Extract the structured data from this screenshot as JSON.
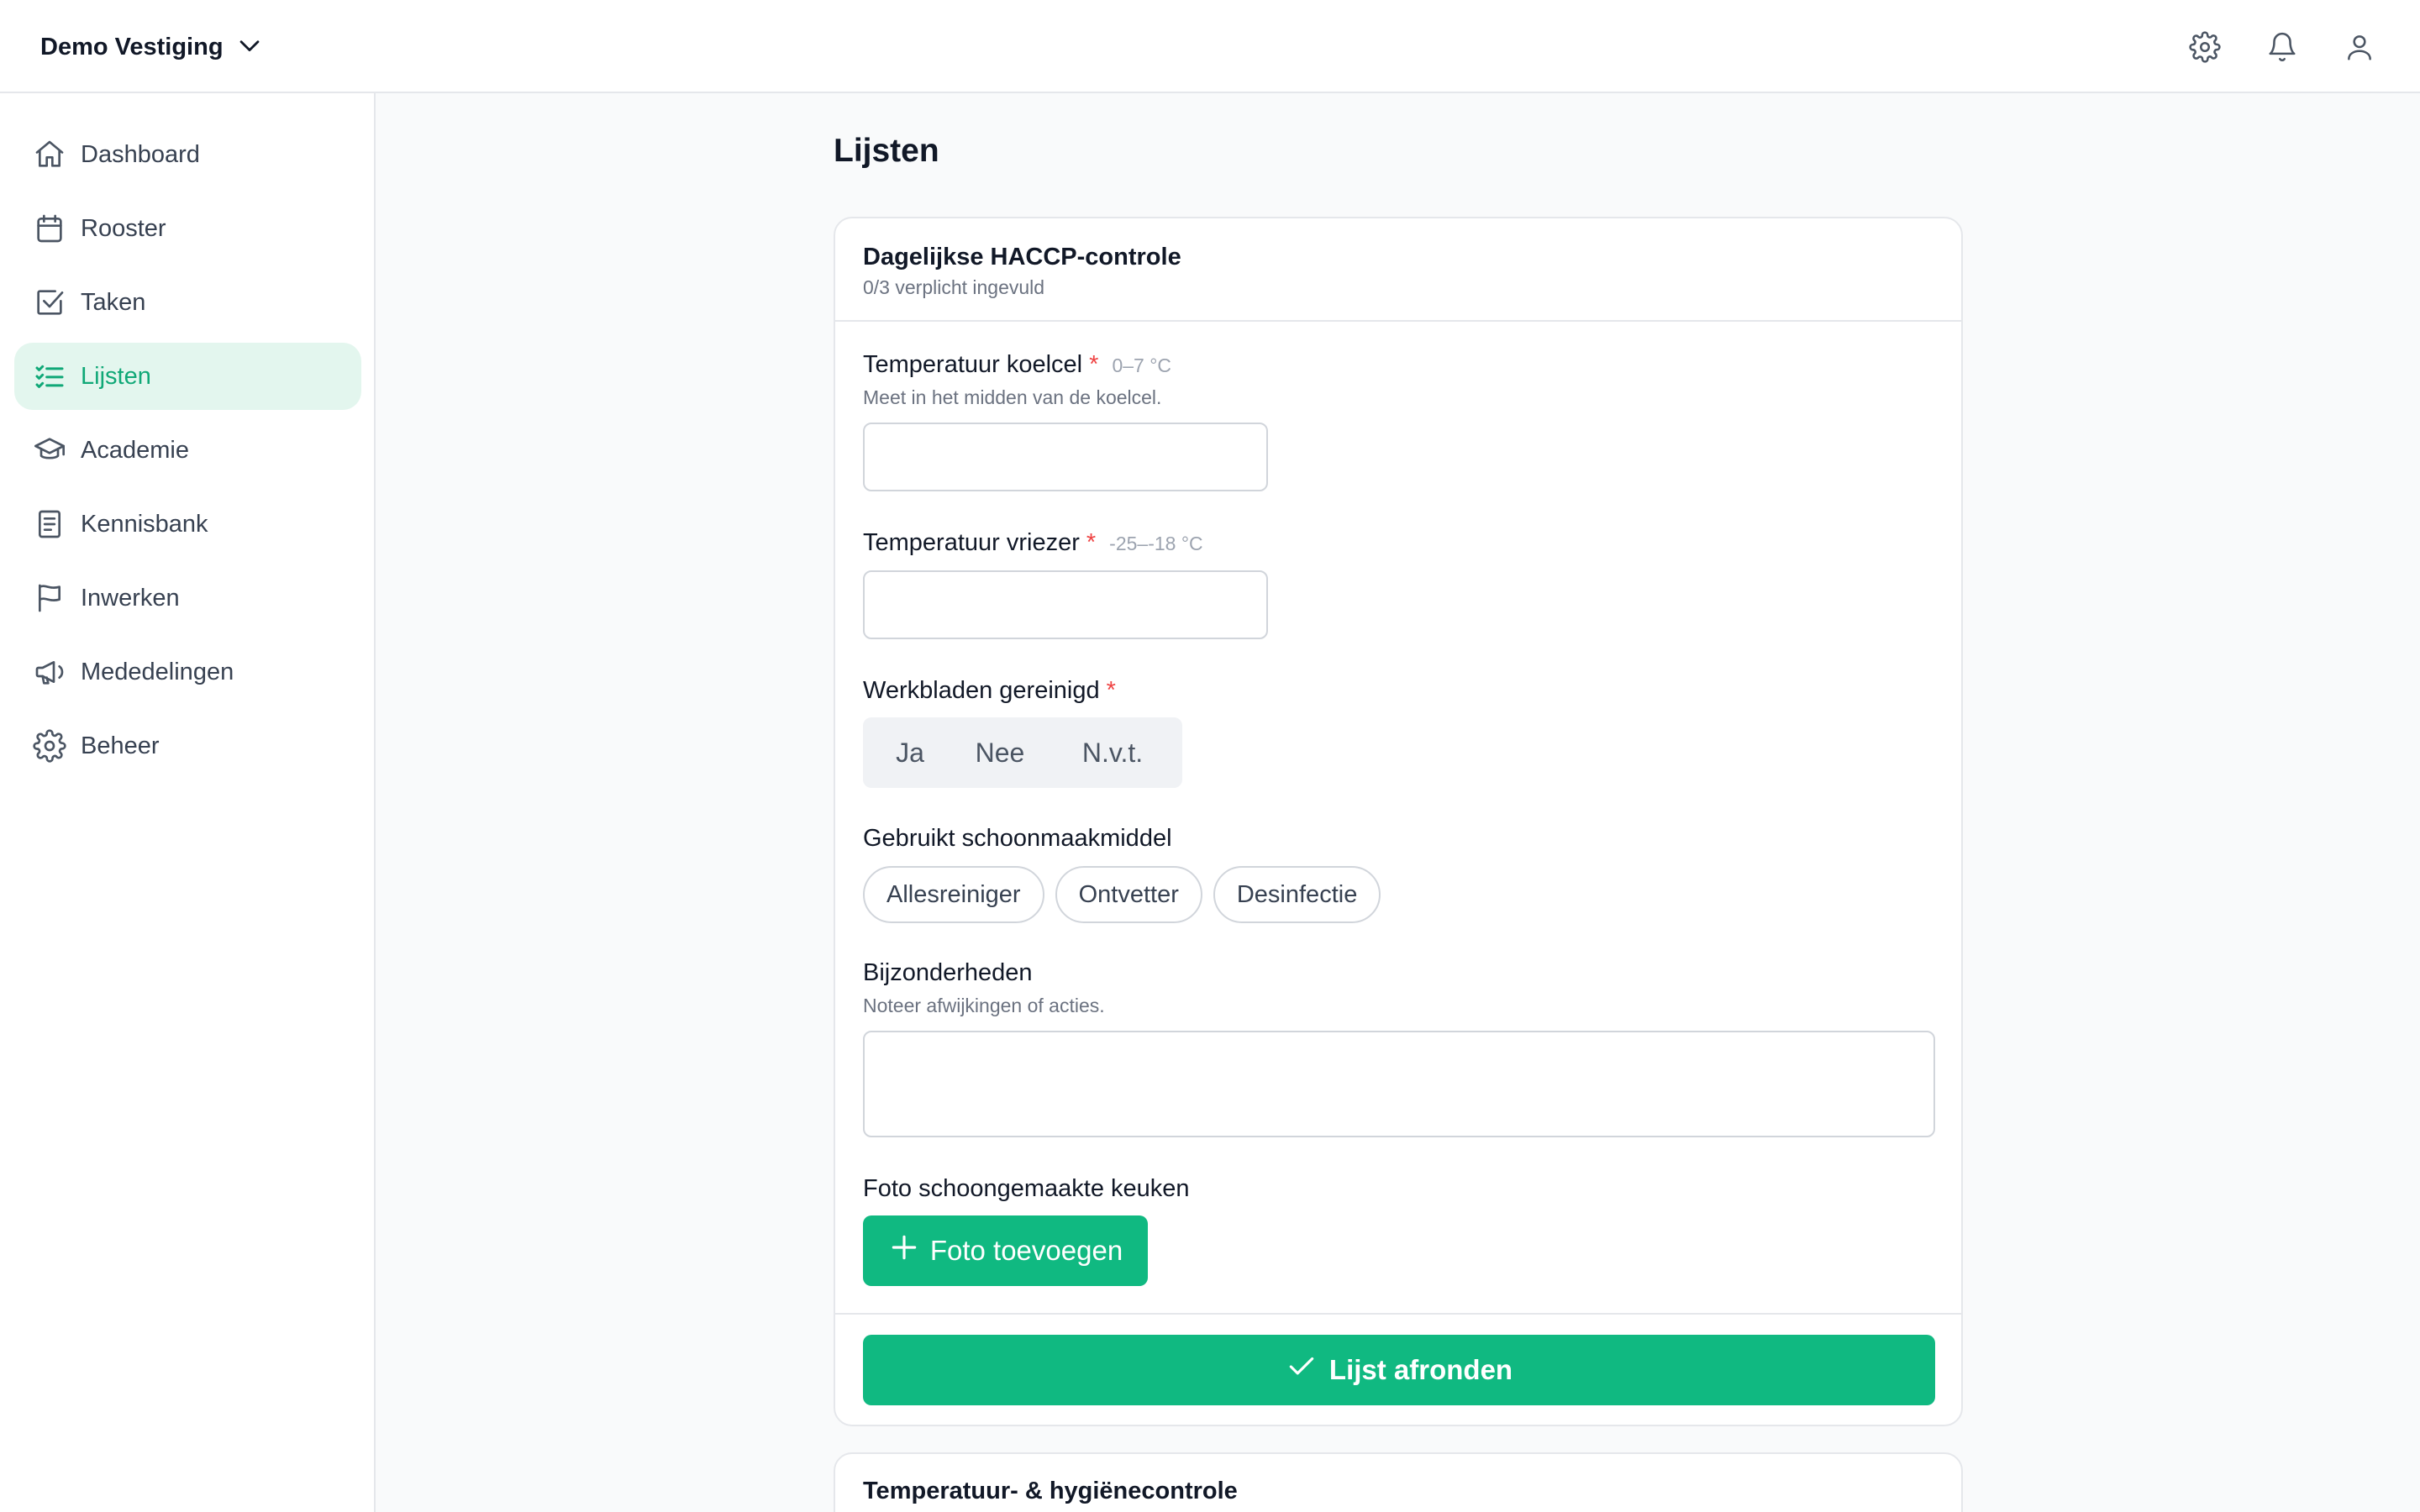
{
  "header": {
    "location": "Demo Vestiging",
    "icons": [
      "gear-icon",
      "bell-icon",
      "user-icon"
    ]
  },
  "sidebar": {
    "items": [
      {
        "label": "Dashboard",
        "icon": "home-icon",
        "active": false
      },
      {
        "label": "Rooster",
        "icon": "calendar-icon",
        "active": false
      },
      {
        "label": "Taken",
        "icon": "checkbox-icon",
        "active": false
      },
      {
        "label": "Lijsten",
        "icon": "list-check-icon",
        "active": true
      },
      {
        "label": "Academie",
        "icon": "graduation-cap-icon",
        "active": false
      },
      {
        "label": "Kennisbank",
        "icon": "book-icon",
        "active": false
      },
      {
        "label": "Inwerken",
        "icon": "flag-icon",
        "active": false
      },
      {
        "label": "Mededelingen",
        "icon": "megaphone-icon",
        "active": false
      },
      {
        "label": "Beheer",
        "icon": "gear-icon",
        "active": false
      }
    ]
  },
  "main": {
    "title": "Lijsten",
    "checklist": {
      "title": "Dagelijkse HACCP-controle",
      "progress": "0/3 verplicht ingevuld",
      "fields": {
        "koelcel": {
          "label": "Temperatuur koelcel",
          "required": "*",
          "range": "0–7 °C",
          "help": "Meet in het midden van de koelcel.",
          "value": ""
        },
        "vriezer": {
          "label": "Temperatuur vriezer",
          "required": "*",
          "range": "-25–-18 °C",
          "value": ""
        },
        "werkbladen": {
          "label": "Werkbladen gereinigd",
          "required": "*",
          "options": [
            "Ja",
            "Nee",
            "N.v.t."
          ]
        },
        "schoonmaakmiddel": {
          "label": "Gebruikt schoonmaakmiddel",
          "options": [
            "Allesreiniger",
            "Ontvetter",
            "Desinfectie"
          ]
        },
        "bijzonderheden": {
          "label": "Bijzonderheden",
          "help": "Noteer afwijkingen of acties.",
          "value": ""
        },
        "foto": {
          "label": "Foto schoongemaakte keuken",
          "button": "Foto toevoegen"
        }
      },
      "submit": "Lijst afronden"
    },
    "next_checklist": {
      "title": "Temperatuur- & hygiënecontrole"
    }
  },
  "colors": {
    "accent": "#10b981",
    "accent_active_bg": "#e3f6ee",
    "required": "#ef4444"
  }
}
